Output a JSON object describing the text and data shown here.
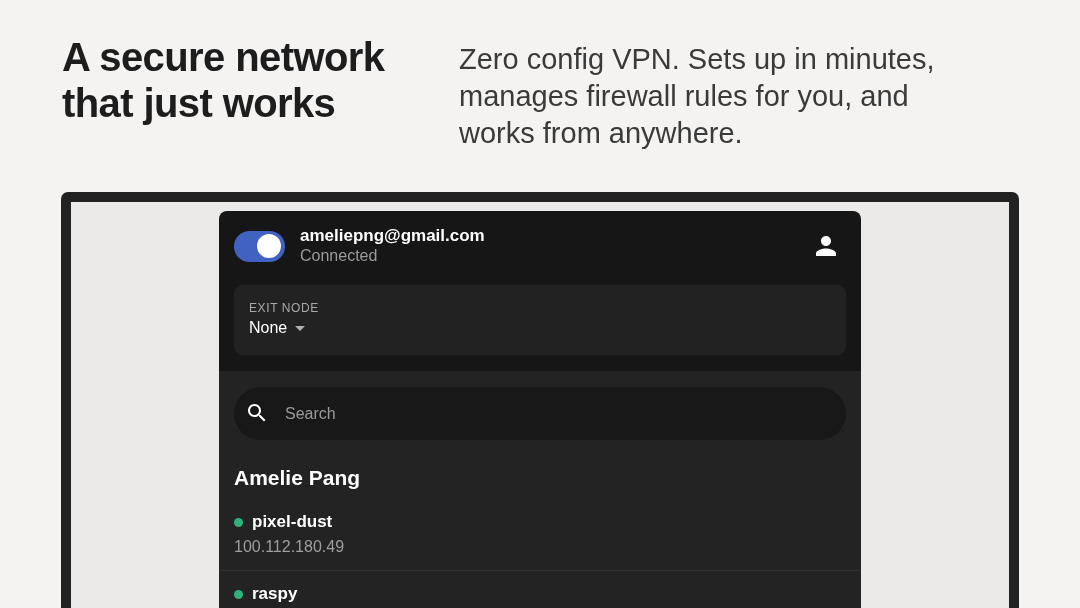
{
  "hero": {
    "headline": "A secure network that just works",
    "tagline": "Zero config VPN. Sets up in minutes, manages firewall rules for you, and works from anywhere."
  },
  "app": {
    "vpn_toggle": {
      "on": true
    },
    "account": {
      "email": "ameliepng@gmail.com",
      "status": "Connected"
    },
    "exit_node": {
      "label": "EXIT NODE",
      "value": "None"
    },
    "search": {
      "placeholder": "Search"
    },
    "owner": "Amelie Pang",
    "devices": [
      {
        "name": "pixel-dust",
        "address": "100.112.180.49",
        "online": true
      },
      {
        "name": "raspy",
        "online": true
      }
    ]
  }
}
